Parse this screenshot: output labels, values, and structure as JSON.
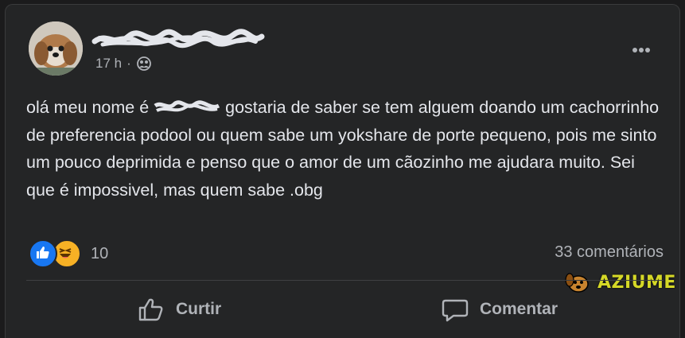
{
  "post": {
    "author_name": "",
    "timestamp": "17 h",
    "separator": "·",
    "audience_icon": "friends-icon",
    "text_before_name": "olá meu nome é ",
    "text_after_name": " gostaria de saber se tem alguem doando um cachorrinho de preferencia podool ou quem sabe um yokshare de porte pequeno, pois me sinto um pouco deprimida e penso que o amor de um cãozinho me ajudara muito. Sei que é impossivel, mas quem sabe .obg"
  },
  "reactions": {
    "icons": [
      "like-icon",
      "haha-icon"
    ],
    "count": "10"
  },
  "comments_label": "33 comentários",
  "actions": {
    "like_label": "Curtir",
    "comment_label": "Comentar"
  },
  "watermark": {
    "text": "AZIUME"
  },
  "colors": {
    "background": "#242526",
    "text": "#e4e6eb",
    "secondary_text": "#b0b3b8",
    "like_blue": "#1877f2",
    "haha_yellow": "#f7b125",
    "watermark_yellow": "#d5d827"
  }
}
